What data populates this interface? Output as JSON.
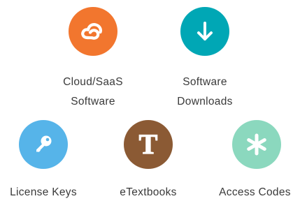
{
  "tiles": {
    "cloud": {
      "label_line1": "Cloud/SaaS",
      "label_line2": "Software",
      "icon": "cloud-icon",
      "color": "#F2762E"
    },
    "downloads": {
      "label_line1": "Software",
      "label_line2": "Downloads",
      "icon": "download-arrow-icon",
      "color": "#00A7B5"
    },
    "license": {
      "label": "License Keys",
      "icon": "key-icon",
      "color": "#56B4E9"
    },
    "etextbooks": {
      "label": "eTextbooks",
      "icon": "letter-t-icon",
      "glyph": "T",
      "color": "#8B5A34"
    },
    "access": {
      "label": "Access Codes",
      "icon": "asterisk-icon",
      "color": "#8BD8BE"
    }
  }
}
